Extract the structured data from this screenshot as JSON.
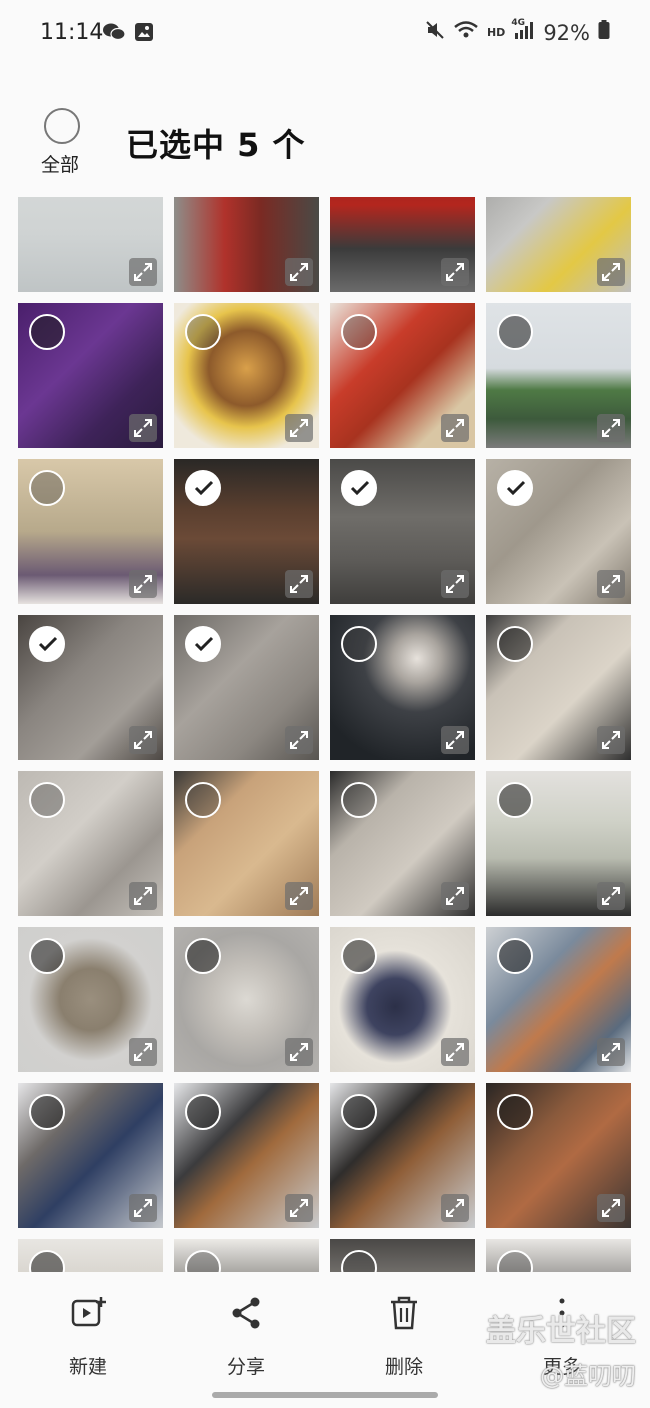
{
  "status_bar": {
    "time": "11:14",
    "left_icons": [
      "wechat-icon",
      "gallery-icon"
    ],
    "right_icons": [
      "mute-icon",
      "wifi-icon",
      "signal-icon",
      "battery-icon"
    ],
    "hd_label": "HD",
    "net_label": "4G",
    "battery_text": "92%"
  },
  "header": {
    "select_all_label": "全部",
    "title": "已选中 5 个"
  },
  "photos": [
    {
      "state": "none",
      "bg": "linear-gradient(180deg,#d9dcdb 0%,#cfd3d3 60%,#bfc4c5 100%)"
    },
    {
      "state": "none",
      "bg": "linear-gradient(90deg,#8e8e8a 0%,#b0322b 35%,#7a2a23 60%,#4a4a46 100%)"
    },
    {
      "state": "none",
      "bg": "linear-gradient(180deg,#8c1d18 0%,#b3261e 40%,#3b3b3b 70%,#6b6b6b 100%)"
    },
    {
      "state": "none",
      "bg": "linear-gradient(135deg,#9a9a98 0%,#c8c8c6 40%,#e3c845 70%,#c0c0c0 100%)"
    },
    {
      "state": "plain",
      "bg": "linear-gradient(135deg,#4a1f6b 0%,#6b3792 40%,#3e2359 70%,#2a1b3d 100%)"
    },
    {
      "state": "empty",
      "bg": "radial-gradient(circle at 50% 45%,#d9a04a 0%,#8d5a2b 35%,#e7c44c 55%,#efe9dc 80%)"
    },
    {
      "state": "empty",
      "bg": "linear-gradient(135deg,#e9e3da 0%,#c83c2a 35%,#a8331f 55%,#d9c6a4 80%)"
    },
    {
      "state": "plain",
      "bg": "linear-gradient(180deg,#dfe3e6 0%,#d6dbdf 45%,#4f7a45 60%,#3d5a3c 80%,#7b7b7b 100%)"
    },
    {
      "state": "empty",
      "bg": "linear-gradient(180deg,#d8c8a9 0%,#b7a98b 50%,#6b5a73 80%,#e6e2df 100%)"
    },
    {
      "state": "checked",
      "bg": "linear-gradient(180deg,#2a2826 0%,#5a3f2f 35%,#6b4a37 55%,#2b2a28 100%)"
    },
    {
      "state": "checked",
      "bg": "linear-gradient(180deg,#4b4a48 0%,#6f6d69 40%,#5d5b58 70%,#3f3e3c 100%)"
    },
    {
      "state": "checked",
      "bg": "linear-gradient(135deg,#b7b1a6 0%,#9f988c 40%,#c9c2b6 70%,#7f786d 100%)"
    },
    {
      "state": "checked",
      "bg": "linear-gradient(135deg,#4a4541 0%,#8a8580 40%,#a39e98 70%,#4d4844 100%)"
    },
    {
      "state": "checked",
      "bg": "linear-gradient(135deg,#6d6a66 0%,#a7a29c 40%,#8c8781 70%,#585551 100%)"
    },
    {
      "state": "empty",
      "bg": "radial-gradient(circle at 60% 30%,#e7e2dc 0%,#a9a49e 18%,#3e4146 40%,#202428 80%)"
    },
    {
      "state": "plain",
      "bg": "linear-gradient(135deg,#3b3b3b 0%,#c9c2b7 30%,#dbd4c8 60%,#2f2f2f 100%)"
    },
    {
      "state": "empty",
      "bg": "linear-gradient(135deg,#bdb9b3 0%,#d2cec8 40%,#9b9690 70%,#c6c2bc 100%)"
    },
    {
      "state": "empty",
      "bg": "linear-gradient(135deg,#3a3937 0%,#c8a27a 30%,#d9b98f 60%,#9f7b57 100%)"
    },
    {
      "state": "empty",
      "bg": "linear-gradient(135deg,#2b2b2b 0%,#b9b3aa 30%,#d0cac1 60%,#2e2e2e 100%)"
    },
    {
      "state": "plain",
      "bg": "linear-gradient(180deg,#e3e1de 0%,#cfd1c7 35%,#b9bcb0 60%,#2c2c2c 100%)"
    },
    {
      "state": "plain",
      "bg": "radial-gradient(circle at 50% 50%,#9a8f7e 0%,#8a7f6e 30%,#d2d1cf 60%,#cfcfcd 100%)"
    },
    {
      "state": "plain",
      "bg": "radial-gradient(circle at 50% 50%,#dcd9d3 0%,#c2beb8 35%,#a9a7a4 65%,#b3b1ae 100%)"
    },
    {
      "state": "plain",
      "bg": "radial-gradient(circle at 45% 55%,#2c3048 0%,#3e4360 25%,#e6e2da 50%,#d8d4cc 100%)"
    },
    {
      "state": "plain",
      "bg": "linear-gradient(135deg,#cdd0d3 0%,#7a8a9c 35%,#c07a4c 55%,#5a6b7e 80%,#e1e3e5 100%)"
    },
    {
      "state": "plain",
      "bg": "linear-gradient(135deg,#e6e6e8 0%,#6e6a68 30%,#2f3f63 55%,#c5c8cc 100%)"
    },
    {
      "state": "plain",
      "bg": "linear-gradient(135deg,#e6e7e9 0%,#3b3b3d 35%,#a06a3d 55%,#c9cbcd 100%)"
    },
    {
      "state": "plain",
      "bg": "linear-gradient(135deg,#e5e6e8 0%,#2f2d2c 35%,#8f5e38 55%,#cacdd0 100%)"
    },
    {
      "state": "plain",
      "bg": "linear-gradient(135deg,#2a2624 0%,#8a5a3c 35%,#b06a43 55%,#3b3533 100%)"
    },
    {
      "state": "plain",
      "bg": "linear-gradient(180deg,#e8e6e2 0%,#c9c4bb 50%,#b7b1a6 100%)"
    },
    {
      "state": "empty",
      "bg": "linear-gradient(180deg,#eceae6 0%,#3a3836 60%,#5a5856 100%)"
    },
    {
      "state": "empty",
      "bg": "linear-gradient(180deg,#4a4846 0%,#9c9892 50%,#d6d2cb 100%)"
    },
    {
      "state": "empty",
      "bg": "linear-gradient(180deg,#e8e6e3 0%,#3d3b39 60%,#4c4a48 100%)"
    }
  ],
  "actions": [
    {
      "name": "new",
      "label": "新建",
      "icon": "new-video-icon"
    },
    {
      "name": "share",
      "label": "分享",
      "icon": "share-icon"
    },
    {
      "name": "delete",
      "label": "删除",
      "icon": "trash-icon"
    },
    {
      "name": "more",
      "label": "更多",
      "icon": "more-icon"
    }
  ],
  "watermark": {
    "line1": "盖乐世社区",
    "line2": "@蓝叨叨"
  }
}
